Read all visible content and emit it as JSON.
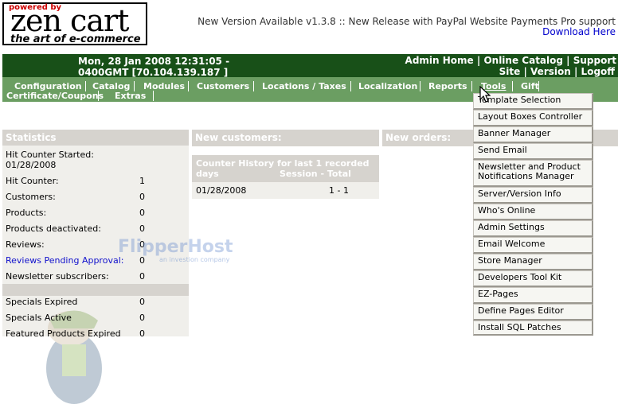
{
  "logo": {
    "powered_by": "powered by",
    "brand": "zen cart",
    "tagline": "the art of e-commerce"
  },
  "top": {
    "version_message": "New Version Available v1.3.8 :: New Release with PayPal Website Payments Pro support",
    "download_link": "Download Here"
  },
  "header": {
    "date_line1": "Mon, 28 Jan 2008 12:31:05 -",
    "date_line2": "0400GMT [70.104.139.187 ]",
    "link_admin_home": "Admin Home",
    "link_online_catalog": "Online Catalog",
    "link_support": "Support",
    "link_site": "Site",
    "link_version": "Version",
    "link_logoff": "Logoff",
    "separator": "|"
  },
  "menu": {
    "configuration": "Configuration",
    "catalog": "Catalog",
    "modules": "Modules",
    "customers": "Customers",
    "locations_taxes": "Locations / Taxes",
    "localization": "Localization",
    "reports": "Reports",
    "tools": "Tools",
    "gift": "Gift",
    "certificate_coupons": "Certificate/Coupons",
    "extras": "Extras"
  },
  "statistics": {
    "title": "Statistics",
    "rows": [
      {
        "label": "Hit Counter Started:",
        "label2": "01/28/2008",
        "value": ""
      },
      {
        "label": "Hit Counter:",
        "value": "1"
      },
      {
        "label": "Customers:",
        "value": "0"
      },
      {
        "label": "Products:",
        "value": "0"
      },
      {
        "label": "Products deactivated:",
        "value": "0"
      },
      {
        "label": "Reviews:",
        "value": "0"
      },
      {
        "label": "Reviews Pending Approval:",
        "value": "0"
      },
      {
        "label": "Newsletter subscribers:",
        "value": "0"
      },
      {
        "label": "Specials Expired",
        "value": "0"
      },
      {
        "label": "Specials Active",
        "value": "0"
      },
      {
        "label": "Featured Products Expired",
        "value": "0"
      }
    ]
  },
  "customers_panel": {
    "title": "New customers:"
  },
  "orders_panel": {
    "title": "New orders:"
  },
  "counter_history": {
    "title": "Counter History for last 1 recorded days",
    "col_session_total": "Session - Total",
    "rows": [
      {
        "date": "01/28/2008",
        "value": "1 - 1"
      }
    ]
  },
  "watermark": {
    "main": "FlipperHost",
    "sub": "an investion company"
  },
  "tools_menu": {
    "items": [
      "Template Selection",
      "Layout Boxes Controller",
      "Banner Manager",
      "Send Email",
      "Newsletter and Product Notifications Manager",
      "Server/Version Info",
      "Who's Online",
      "Admin Settings",
      "Email Welcome",
      "Store Manager",
      "Developers Tool Kit",
      "EZ-Pages",
      "Define Pages Editor",
      "Install SQL Patches"
    ]
  },
  "colors": {
    "header_bg": "#185018",
    "menu_bg": "#6b9e62",
    "panel_head_bg": "#d6d3ce",
    "panel_bg": "#f0efeb",
    "link": "#0000cc"
  }
}
